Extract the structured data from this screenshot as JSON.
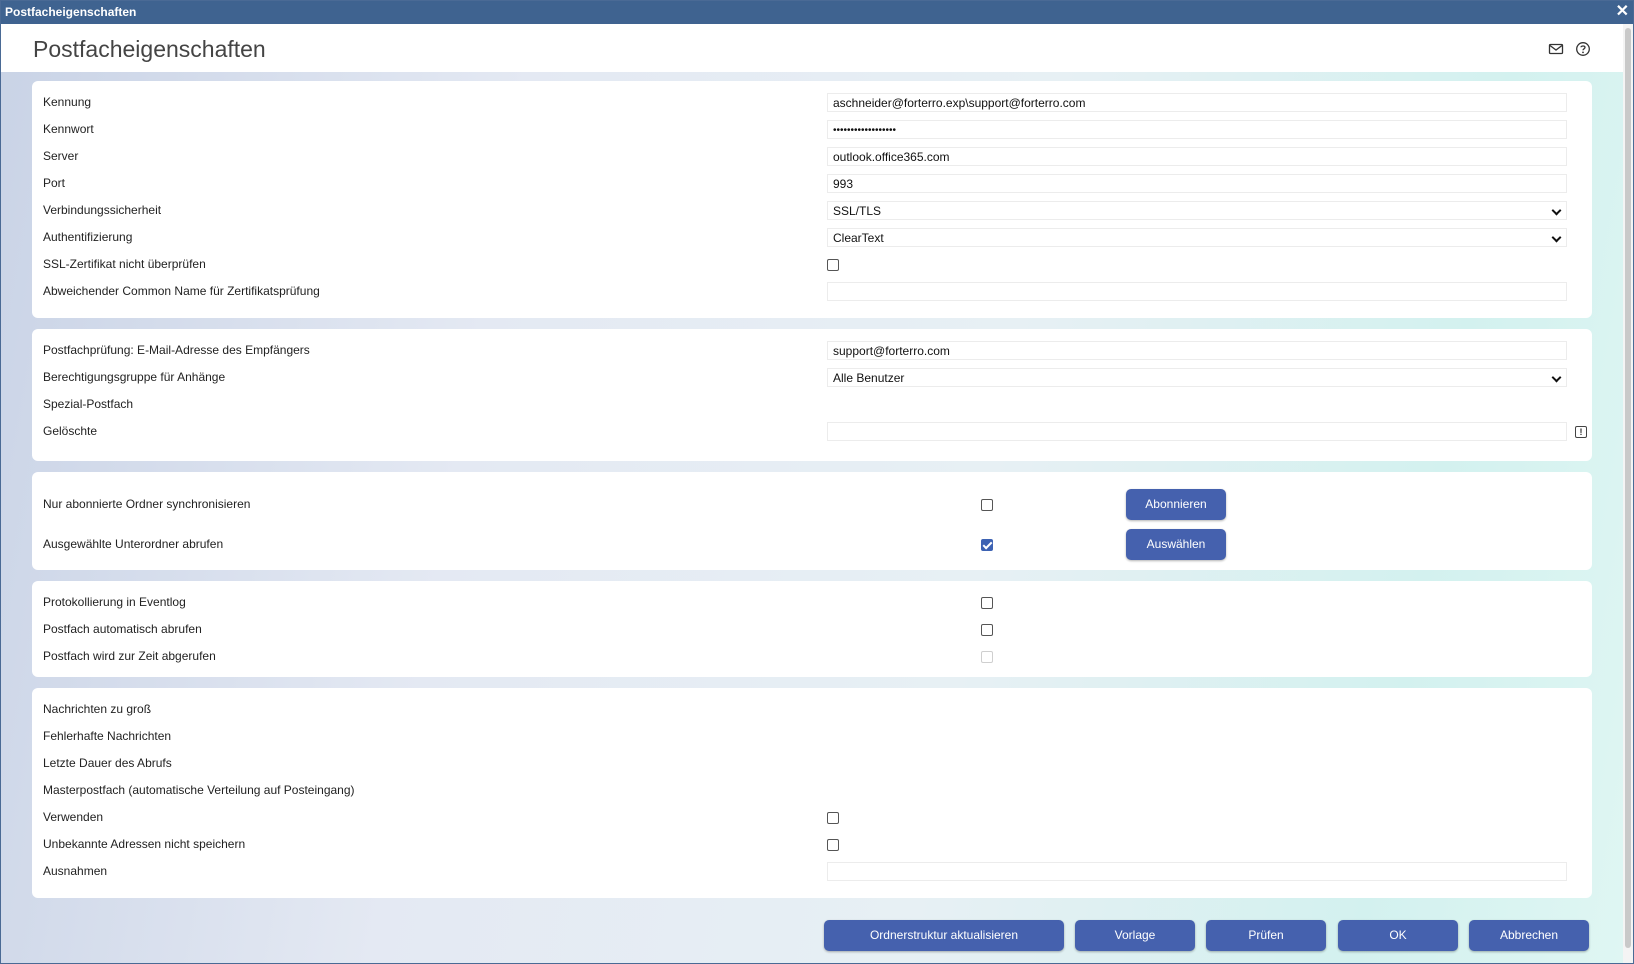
{
  "window": {
    "title": "Postfacheigenschaften",
    "close_glyph": "✕"
  },
  "header": {
    "title": "Postfacheigenschaften",
    "icons": [
      "mail-icon",
      "help-icon"
    ]
  },
  "section1": {
    "kennung": {
      "label": "Kennung",
      "value": "aschneider@forterro.exp\\support@forterro.com"
    },
    "kennwort": {
      "label": "Kennwort",
      "value": "••••••••••••••••••"
    },
    "server": {
      "label": "Server",
      "value": "outlook.office365.com"
    },
    "port": {
      "label": "Port",
      "value": "993"
    },
    "verbindung": {
      "label": "Verbindungssicherheit",
      "value": "SSL/TLS"
    },
    "auth": {
      "label": "Authentifizierung",
      "value": "ClearText"
    },
    "ssl": {
      "label": "SSL-Zertifikat nicht überprüfen",
      "checked": false
    },
    "common_name": {
      "label": "Abweichender Common Name für Zertifikatsprüfung",
      "value": ""
    }
  },
  "section2": {
    "empfaenger": {
      "label": "Postfachprüfung: E-Mail-Adresse des Empfängers",
      "value": "support@forterro.com"
    },
    "gruppe": {
      "label": "Berechtigungsgruppe für Anhänge",
      "value": "Alle Benutzer"
    },
    "spezial": {
      "label": "Spezial-Postfach"
    },
    "geloeschte": {
      "label": "Gelöschte",
      "value": ""
    }
  },
  "section3": {
    "abonniert": {
      "label": "Nur abonnierte Ordner synchronisieren",
      "checked": false,
      "button": "Abonnieren"
    },
    "unterordner": {
      "label": "Ausgewählte Unterordner abrufen",
      "checked": true,
      "button": "Auswählen"
    }
  },
  "section4": {
    "protokoll": {
      "label": "Protokollierung in Eventlog",
      "checked": false
    },
    "automatisch": {
      "label": "Postfach automatisch abrufen",
      "checked": false
    },
    "abgerufen": {
      "label": "Postfach wird zur Zeit abgerufen",
      "checked": false,
      "disabled": true
    }
  },
  "section5": {
    "zu_gross": {
      "label": "Nachrichten zu groß"
    },
    "fehlerhaft": {
      "label": "Fehlerhafte Nachrichten"
    },
    "dauer": {
      "label": "Letzte Dauer des Abrufs"
    },
    "master": {
      "label": "Masterpostfach (automatische Verteilung auf Posteingang)"
    },
    "verwenden": {
      "label": "Verwenden",
      "checked": false
    },
    "unbekannt": {
      "label": "Unbekannte Adressen nicht speichern",
      "checked": false
    },
    "ausnahmen": {
      "label": "Ausnahmen",
      "value": ""
    }
  },
  "footer": {
    "ordnerstruktur": "Ordnerstruktur aktualisieren",
    "vorlage": "Vorlage",
    "pruefen": "Prüfen",
    "ok": "OK",
    "abbrechen": "Abbrechen"
  },
  "colors": {
    "titlebar": "#3f6390",
    "button": "#4561ae",
    "checkbox_checked": "#3d62b3"
  }
}
